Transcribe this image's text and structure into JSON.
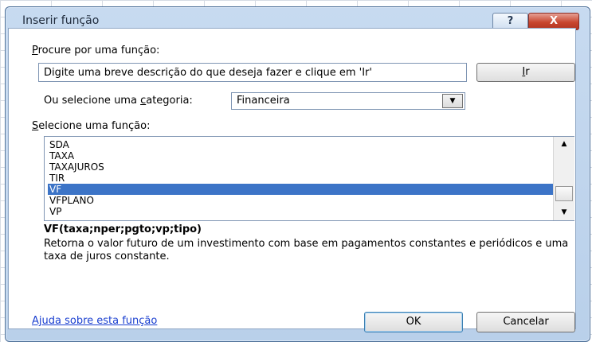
{
  "dialog": {
    "title": "Inserir função",
    "help_button": "?",
    "close_button": "X"
  },
  "search": {
    "label_prefix": "P",
    "label_rest": "rocure por uma função:",
    "value": "Digite uma breve descrição do que deseja fazer e clique em 'Ir'",
    "go_button_accel": "I",
    "go_button_rest": "r"
  },
  "category": {
    "label_before": "Ou selecione uma ",
    "label_accel": "c",
    "label_after": "ategoria:",
    "selected": "Financeira",
    "arrow_icon": "chevron-down-icon"
  },
  "function_list": {
    "label_accel": "S",
    "label_rest": "elecione uma função:",
    "items": [
      "SDA",
      "TAXA",
      "TAXAJUROS",
      "TIR",
      "VF",
      "VFPLANO",
      "VP"
    ],
    "selected_index": 4
  },
  "details": {
    "signature": "VF(taxa;nper;pgto;vp;tipo)",
    "description": "Retorna o valor futuro de um investimento com base em pagamentos constantes e periódicos e uma taxa de juros constante."
  },
  "footer": {
    "help_link": "Ajuda sobre esta função",
    "ok_button": "OK",
    "cancel_button": "Cancelar"
  },
  "colors": {
    "title_bar": "#c7daf0",
    "selection": "#3c74c7",
    "link": "#1a3fd0",
    "close": "#c8462f"
  }
}
